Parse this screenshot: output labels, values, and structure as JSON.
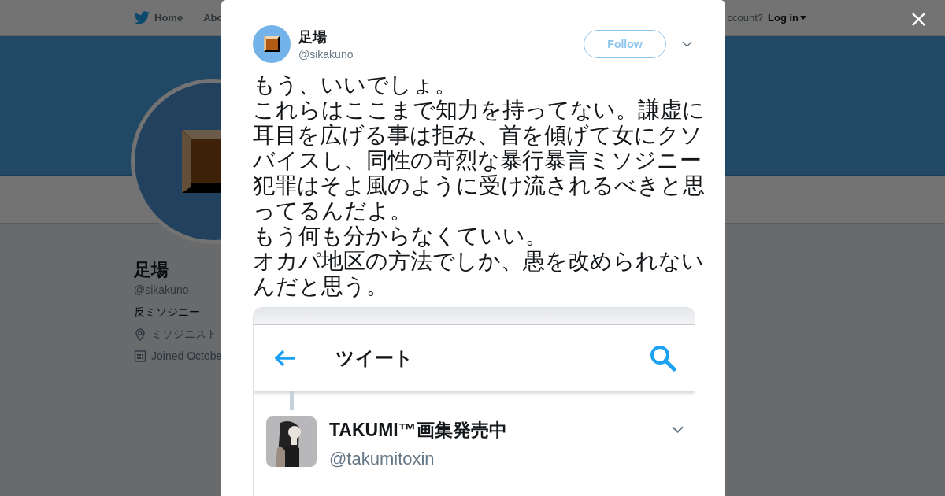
{
  "background_page": {
    "nav": {
      "home": "Home",
      "about": "Abo",
      "account_prompt": "ccount?",
      "login": "Log in"
    },
    "profile": {
      "name": "足場",
      "handle": "@sikakuno",
      "bio": "反ミソジニー",
      "location": "ミソジニスト",
      "joined": "Joined Octobe"
    }
  },
  "tweet": {
    "author": {
      "name": "足場",
      "handle": "@sikakuno"
    },
    "follow_button": "Follow",
    "text": [
      "もう、いいでしょ。",
      "これらはここまで知力を持ってない。謙虚に耳目を広げる事は拒み、首を傾げて女にクソバイスし、同性の苛烈な暴行暴言ミソジニー犯罪はそよ風のように受け流されるべきと思ってるんだよ。",
      "もう何も分からなくていい。",
      "オカパ地区の方法でしか、愚を改められないんだと思う。"
    ],
    "embedded_image": {
      "title": "ツイート",
      "author_name": "TAKUMI™画集発売中",
      "author_handle": "@takumitoxin"
    }
  }
}
